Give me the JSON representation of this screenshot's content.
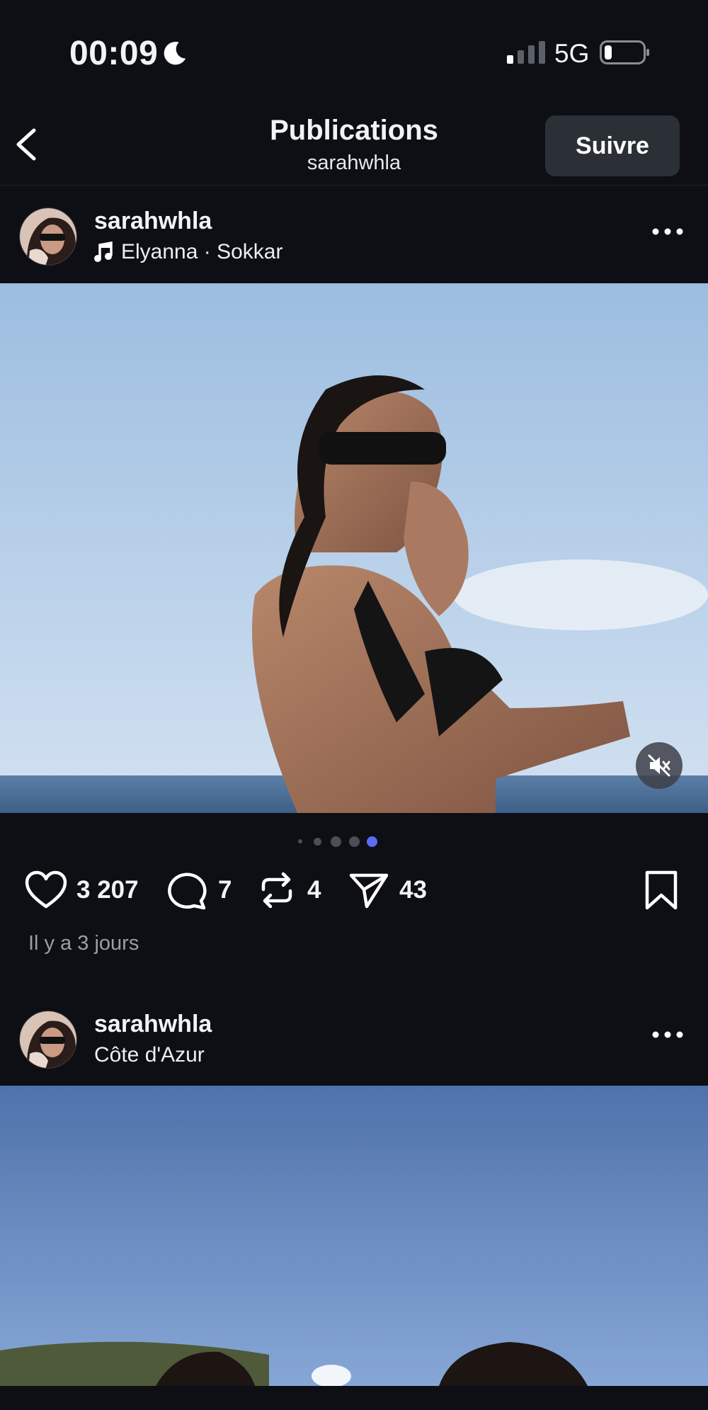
{
  "status_bar": {
    "time": "00:09",
    "network": "5G"
  },
  "header": {
    "title": "Publications",
    "subtitle": "sarahwhla",
    "follow_label": "Suivre"
  },
  "post1": {
    "username": "sarahwhla",
    "music": "Elyanna · Sokkar",
    "carousel_count": 5,
    "carousel_active": 4,
    "likes": "3 207",
    "comments": "7",
    "reposts": "4",
    "shares": "43",
    "time_ago": "Il y a 3 jours"
  },
  "post2": {
    "username": "sarahwhla",
    "location": "Côte d'Azur"
  },
  "icons": {
    "back": "chevron-left-icon",
    "moon": "moon-icon",
    "signal": "signal-icon",
    "battery": "battery-icon",
    "music": "music-note-icon",
    "more": "more-horizontal-icon",
    "mute": "volume-off-icon",
    "like": "heart-icon",
    "comment": "comment-icon",
    "repost": "repost-icon",
    "share": "send-icon",
    "save": "bookmark-icon"
  },
  "colors": {
    "background": "#0d0f14",
    "follow_button": "#2b2f36",
    "carousel_active_dot": "#5b6cf5"
  }
}
